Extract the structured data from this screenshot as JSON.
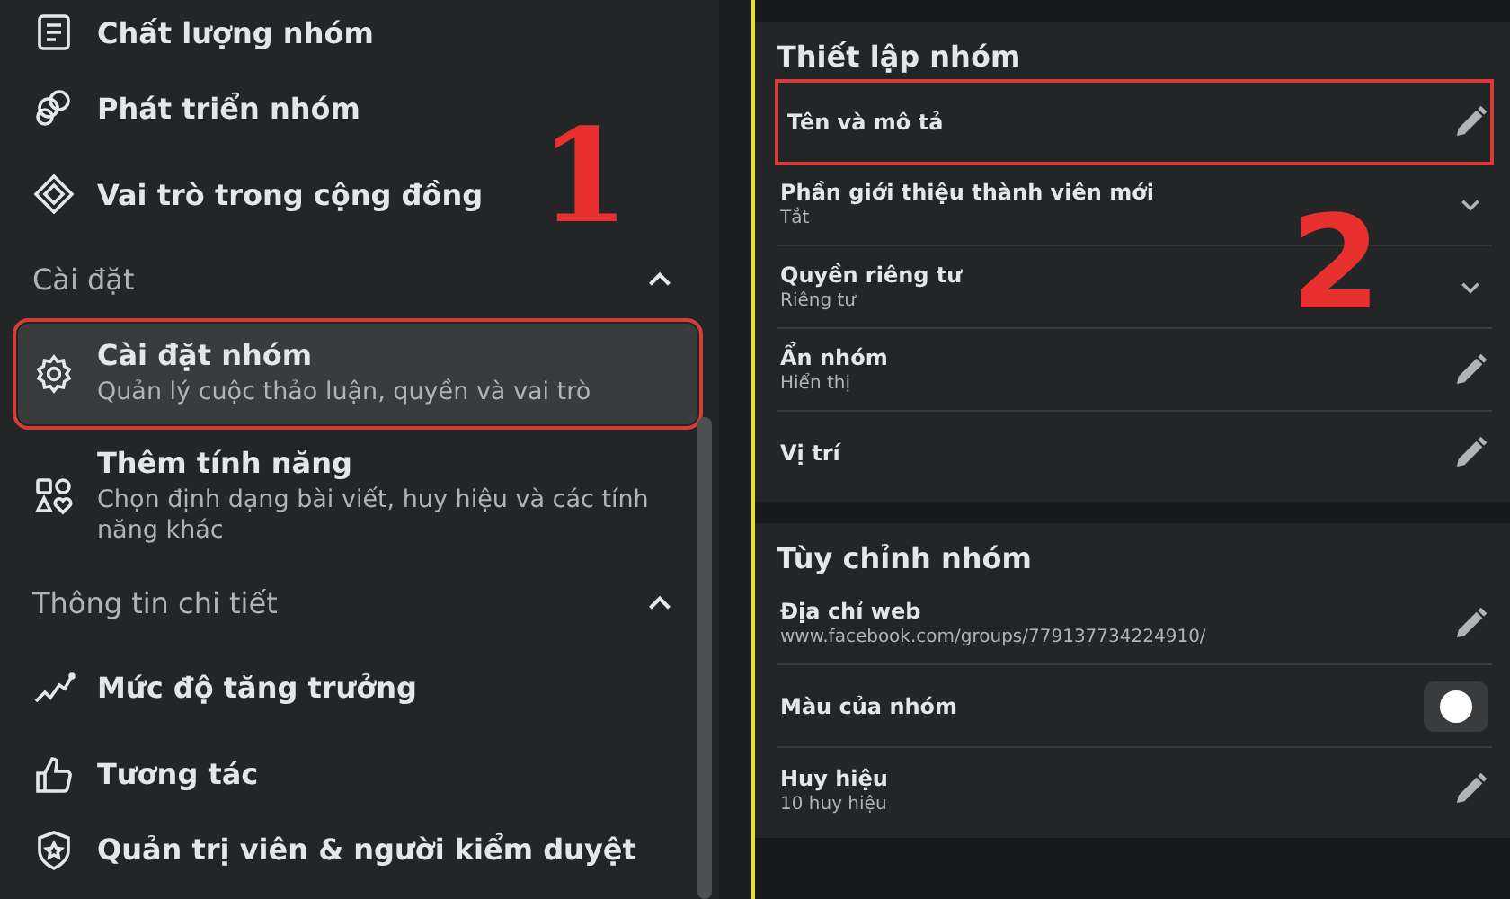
{
  "sidebar": {
    "items": [
      {
        "kind": "nav",
        "label": "Chất lượng nhóm",
        "selected": false,
        "highlighted": false
      },
      {
        "kind": "nav",
        "label": "Phát triển nhóm",
        "selected": false,
        "highlighted": false
      },
      {
        "kind": "nav",
        "label": "Vai trò trong cộng đồng",
        "selected": false,
        "highlighted": false
      },
      {
        "kind": "section",
        "label": "Cài đặt",
        "expanded": true
      },
      {
        "kind": "nav",
        "label": "Cài đặt nhóm",
        "description": "Quản lý cuộc thảo luận, quyền và vai trò",
        "selected": true,
        "highlighted": true
      },
      {
        "kind": "nav",
        "label": "Thêm tính năng",
        "description": "Chọn định dạng bài viết, huy hiệu và các tính năng khác",
        "selected": false,
        "highlighted": false
      },
      {
        "kind": "section",
        "label": "Thông tin chi tiết",
        "expanded": true
      },
      {
        "kind": "nav",
        "label": "Mức độ tăng trưởng",
        "selected": false,
        "highlighted": false
      },
      {
        "kind": "nav",
        "label": "Tương tác",
        "selected": false,
        "highlighted": false
      },
      {
        "kind": "nav",
        "label": "Quản trị viên & người kiểm duyệt",
        "selected": false,
        "highlighted": false
      }
    ]
  },
  "settings": [
    {
      "title": "Thiết lập nhóm",
      "rows": [
        {
          "kind": "edit",
          "label": "Tên và mô tả",
          "highlighted": true
        },
        {
          "kind": "dropdown",
          "label": "Phần giới thiệu thành viên mới",
          "value": "Tắt",
          "highlighted": false
        },
        {
          "kind": "dropdown",
          "label": "Quyền riêng tư",
          "value": "Riêng tư",
          "highlighted": false
        },
        {
          "kind": "edit",
          "label": "Ẩn nhóm",
          "value": "Hiển thị",
          "highlighted": false
        },
        {
          "kind": "edit",
          "label": "Vị trí",
          "highlighted": false
        }
      ]
    },
    {
      "title": "Tùy chỉnh nhóm",
      "rows": [
        {
          "kind": "edit",
          "label": "Địa chỉ web",
          "value": "www.facebook.com/groups/779137734224910/",
          "highlighted": false
        },
        {
          "kind": "color",
          "label": "Màu của nhóm",
          "highlighted": false
        },
        {
          "kind": "edit",
          "label": "Huy hiệu",
          "value": "10 huy hiệu",
          "highlighted": false
        }
      ]
    }
  ],
  "annotations": [
    {
      "label": "1"
    },
    {
      "label": "2"
    }
  ]
}
